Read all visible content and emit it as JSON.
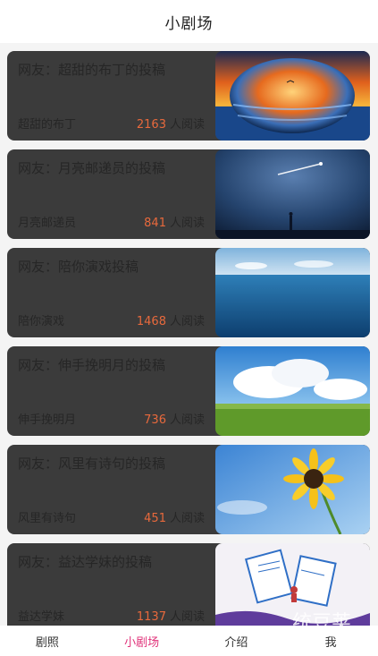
{
  "header": {
    "title": "小剧场"
  },
  "cards": [
    {
      "title": "网友：超甜的布丁的投稿",
      "author": "超甜的布丁",
      "reads": "2163",
      "reads_unit": "人阅读",
      "thumb": "sunset-glass-sphere"
    },
    {
      "title": "网友：月亮邮递员的投稿",
      "author": "月亮邮递员",
      "reads": "841",
      "reads_unit": "人阅读",
      "thumb": "night-sky-shooting-star"
    },
    {
      "title": "网友：陪你演戏投稿",
      "author": "陪你演戏",
      "reads": "1468",
      "reads_unit": "人阅读",
      "thumb": "blue-sea-horizon"
    },
    {
      "title": "网友：伸手挽明月的投稿",
      "author": "伸手挽明月",
      "reads": "736",
      "reads_unit": "人阅读",
      "thumb": "clouds-green-field"
    },
    {
      "title": "网友：风里有诗句的投稿",
      "author": "风里有诗句",
      "reads": "451",
      "reads_unit": "人阅读",
      "thumb": "sunflower-blue-sky"
    },
    {
      "title": "网友：益达学妹的投稿",
      "author": "益达学妹",
      "reads": "1137",
      "reads_unit": "人阅读",
      "thumb": "illustration-papers"
    }
  ],
  "watermark": "统豆荚",
  "tabs": [
    {
      "label": "剧照",
      "active": false
    },
    {
      "label": "小剧场",
      "active": true
    },
    {
      "label": "介绍",
      "active": false
    },
    {
      "label": "我",
      "active": false
    }
  ]
}
